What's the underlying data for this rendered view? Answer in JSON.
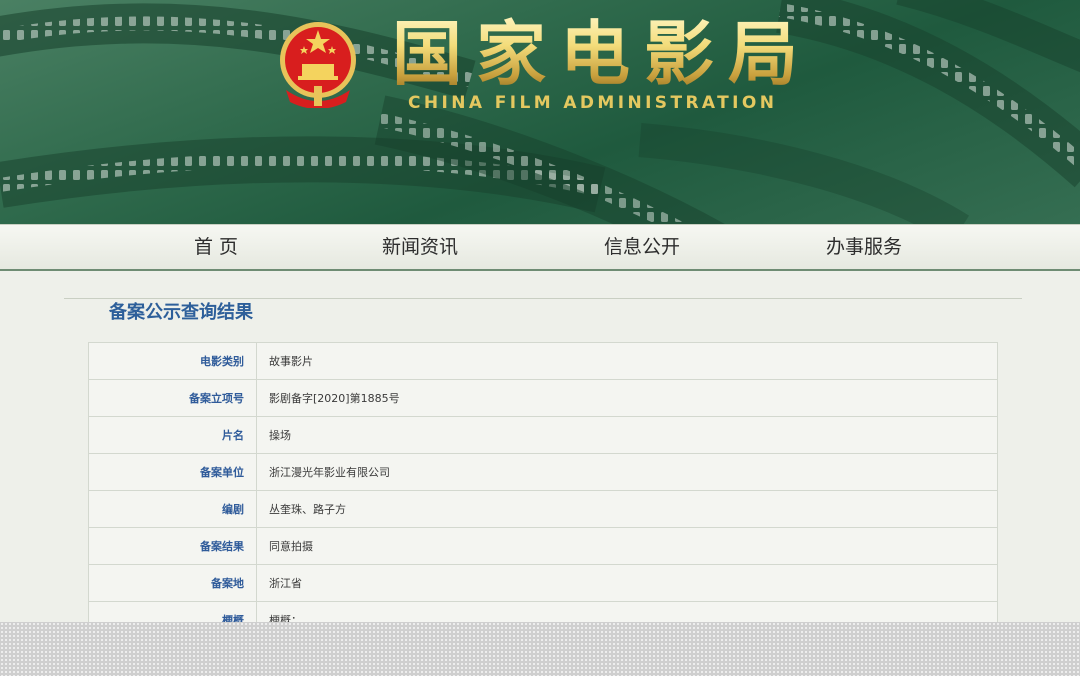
{
  "header": {
    "logo_cn": "国家电影局",
    "logo_en": "CHINA FILM ADMINISTRATION"
  },
  "nav": {
    "items": [
      {
        "label": "首 页"
      },
      {
        "label": "新闻资讯"
      },
      {
        "label": "信息公开"
      },
      {
        "label": "办事服务"
      }
    ]
  },
  "result": {
    "title": "备案公示查询结果",
    "rows": [
      {
        "label": "电影类别",
        "value": "故事影片"
      },
      {
        "label": "备案立项号",
        "value": "影剧备字[2020]第1885号"
      },
      {
        "label": "片名",
        "value": "操场"
      },
      {
        "label": "备案单位",
        "value": "浙江漫光年影业有限公司"
      },
      {
        "label": "编剧",
        "value": "丛奎珠、路子方"
      },
      {
        "label": "备案结果",
        "value": "同意拍摄"
      },
      {
        "label": "备案地",
        "value": "浙江省"
      },
      {
        "label": "梗概",
        "value": "梗概：..."
      }
    ]
  },
  "colors": {
    "banner_green": "#2f6a4c",
    "logo_gold": "#e4c860",
    "label_blue": "#2f5b9a",
    "title_blue": "#2d5f9a"
  }
}
